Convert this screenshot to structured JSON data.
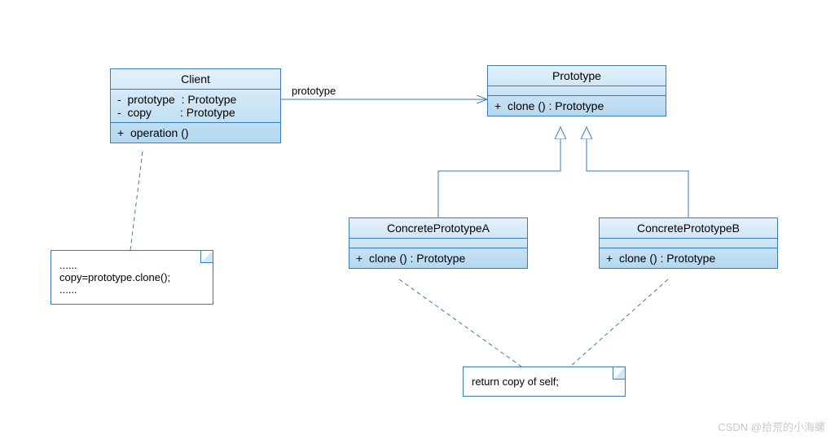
{
  "classes": {
    "client": {
      "name": "Client",
      "attrs": [
        "-  prototype  : Prototype",
        "-  copy         : Prototype"
      ],
      "methods": [
        "+  operation ()"
      ]
    },
    "prototype": {
      "name": "Prototype",
      "methods": [
        "+  clone () : Prototype"
      ]
    },
    "concreteA": {
      "name": "ConcretePrototypeA",
      "methods": [
        "+  clone () : Prototype"
      ]
    },
    "concreteB": {
      "name": "ConcretePrototypeB",
      "methods": [
        "+  clone () : Prototype"
      ]
    }
  },
  "notes": {
    "clientNote": {
      "lines": [
        "......",
        "copy=prototype.clone();",
        "......"
      ]
    },
    "returnNote": {
      "lines": [
        "return copy of self;"
      ]
    }
  },
  "assocLabel": "prototype",
  "watermark": "CSDN @拾荒的小海螺"
}
